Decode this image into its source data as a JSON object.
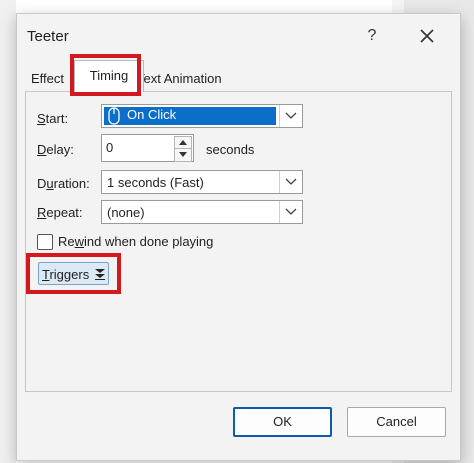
{
  "window": {
    "title": "Teeter",
    "help_glyph": "?"
  },
  "tabs": [
    {
      "label": "Effect",
      "active": false
    },
    {
      "label": "Timing",
      "active": true
    },
    {
      "label": "Text Animation",
      "active": false
    }
  ],
  "timing": {
    "start": {
      "label_accel": "S",
      "label_rest": "tart:",
      "value": "On Click"
    },
    "delay": {
      "label_accel": "D",
      "label_rest": "elay:",
      "value": "0",
      "unit": "seconds"
    },
    "duration": {
      "label_pre": "D",
      "label_accel": "u",
      "label_rest": "ration:",
      "value": "1 seconds (Fast)"
    },
    "repeat": {
      "label_accel": "R",
      "label_rest": "epeat:",
      "value": "(none)"
    },
    "rewind": {
      "label_pre": "Re",
      "label_accel": "w",
      "label_rest": "ind when done playing",
      "checked": false
    },
    "triggers": {
      "label_accel": "T",
      "label_rest": "riggers"
    }
  },
  "buttons": {
    "ok": "OK",
    "cancel": "Cancel"
  },
  "colors": {
    "highlight_red": "#d1191f",
    "selection_blue": "#0b6fc9",
    "ok_border": "#0b5cad"
  }
}
